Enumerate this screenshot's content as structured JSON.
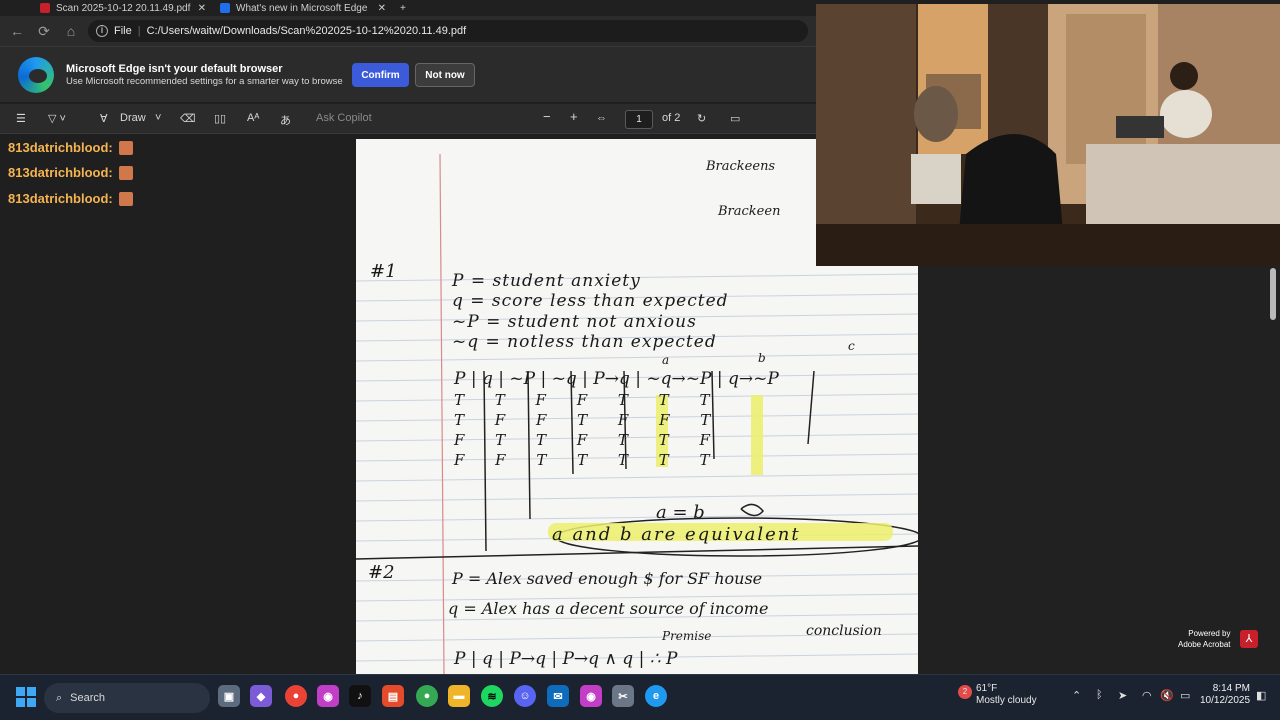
{
  "tabs": [
    {
      "title": "Scan 2025-10-12 20.11.49.pdf",
      "favicon_color": "#c8202a"
    },
    {
      "title": "What's new in Microsoft Edge",
      "favicon_color": "#1f6feb"
    }
  ],
  "address": {
    "file_label": "File",
    "url": "C:/Users/waitw/Downloads/Scan%202025-10-12%2020.11.49.pdf"
  },
  "infobar": {
    "title": "Microsoft Edge isn't your default browser",
    "subtitle": "Use Microsoft recommended settings for a smarter way to browse",
    "confirm": "Confirm",
    "not_now": "Not now"
  },
  "pdf_toolbar": {
    "draw": "Draw",
    "ask_copilot": "Ask Copilot",
    "page_current": "1",
    "page_total": "of 2",
    "zoom_out": "−",
    "zoom_in": "+"
  },
  "chat": {
    "lines": [
      {
        "user": "813datrichblood:"
      },
      {
        "user": "813datrichblood:"
      },
      {
        "user": "813datrichblood:"
      }
    ]
  },
  "notes": {
    "header1": "Brackeens",
    "header2": "Brackeen",
    "p1_label": "#1",
    "p1_p": "P = student anxiety",
    "p1_q": "q = score less than expected",
    "p1_np": "~P = student not anxious",
    "p1_nq": "~q = notless than expected",
    "tt_header": "P | q | ~P | ~q | P→q | ~q→~P | q→~P",
    "col_a": "a",
    "col_b": "b",
    "col_c": "c",
    "rows": [
      "T T F F T T T",
      "T F F T F F T",
      "F T T F T T F",
      "F F T T T T T"
    ],
    "conclusion_eq": "a = b",
    "conclusion": "a and b are equivalent",
    "p2_label": "#2",
    "p2_p": "P = Alex saved enough $ for SF house",
    "p2_q": "q = Alex has a decent source of income",
    "premise": "Premise",
    "conclusion_label": "conclusion",
    "tt2_header": "P | q | P→q | P→q ∧ q | ∴ P"
  },
  "powered": {
    "line1": "Powered by",
    "line2": "Adobe Acrobat"
  },
  "taskbar": {
    "search": "Search",
    "weather_temp": "61°F",
    "weather_desc": "Mostly cloudy",
    "weather_badge": "2",
    "time": "8:14 PM",
    "date": "10/12/2025"
  }
}
